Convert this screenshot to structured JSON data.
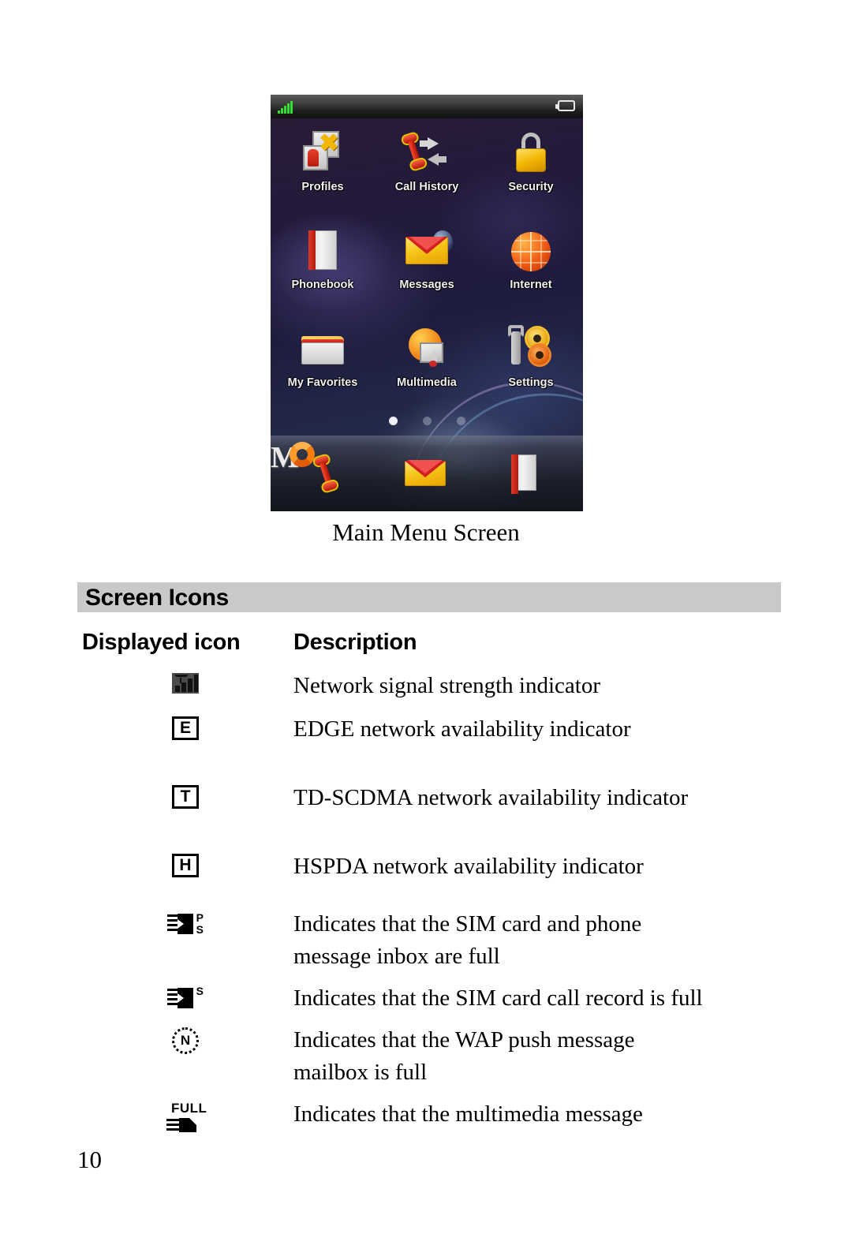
{
  "figure": {
    "caption": "Main Menu Screen",
    "status_bar": {
      "signal_icon": "signal-bars-icon",
      "battery_icon": "battery-icon"
    },
    "apps": [
      {
        "label": "Profiles",
        "icon": "profiles-icon"
      },
      {
        "label": "Call History",
        "icon": "call-history-icon"
      },
      {
        "label": "Security",
        "icon": "security-lock-icon"
      },
      {
        "label": "Phonebook",
        "icon": "phonebook-icon"
      },
      {
        "label": "Messages",
        "icon": "messages-envelope-icon"
      },
      {
        "label": "Internet",
        "icon": "internet-globe-icon"
      },
      {
        "label": "My Favorites",
        "icon": "my-favorites-folder-icon"
      },
      {
        "label": "Multimedia",
        "icon": "multimedia-icon"
      },
      {
        "label": "Settings",
        "icon": "settings-gears-icon"
      }
    ],
    "page_dots": {
      "count": 3,
      "active_index": 0
    },
    "dock": [
      {
        "icon": "dial-handset-icon"
      },
      {
        "icon": "messages-envelope-icon"
      },
      {
        "icon": "phonebook-icon"
      },
      {
        "icon": "mo-music-icon"
      }
    ]
  },
  "section": {
    "heading": "Screen Icons"
  },
  "table": {
    "headers": {
      "icon_column": "Displayed icon",
      "description_column": "Description"
    },
    "rows": [
      {
        "icon": "network-signal-strength-icon",
        "icon_text": "",
        "description": [
          "Network signal strength indicator"
        ]
      },
      {
        "icon": "edge-network-icon",
        "icon_text": "E",
        "description": [
          "EDGE network availability indicator"
        ]
      },
      {
        "icon": "td-scdma-network-icon",
        "icon_text": "T",
        "description": [
          "TD-SCDMA network availability indicator"
        ]
      },
      {
        "icon": "hspda-network-icon",
        "icon_text": "H",
        "description": [
          "HSPDA network availability indicator"
        ]
      },
      {
        "icon": "sim-and-phone-inbox-full-icon",
        "icon_text": "P\nS",
        "description": [
          "Indicates that the SIM card and phone",
          "message inbox are full"
        ]
      },
      {
        "icon": "sim-call-record-full-icon",
        "icon_text": "S",
        "description": [
          "Indicates that the SIM card call record is full"
        ]
      },
      {
        "icon": "wap-push-mailbox-full-icon",
        "icon_text": "N",
        "description": [
          "Indicates that the WAP push message",
          "mailbox is full"
        ]
      },
      {
        "icon": "multimedia-message-full-icon",
        "icon_text": "FULL",
        "description": [
          "Indicates that the multimedia message"
        ]
      }
    ]
  },
  "footer": {
    "page_number": "10"
  },
  "colors": {
    "section_bar": "#c9c9c9",
    "signal_green": "#33dd33",
    "text": "#000000"
  }
}
